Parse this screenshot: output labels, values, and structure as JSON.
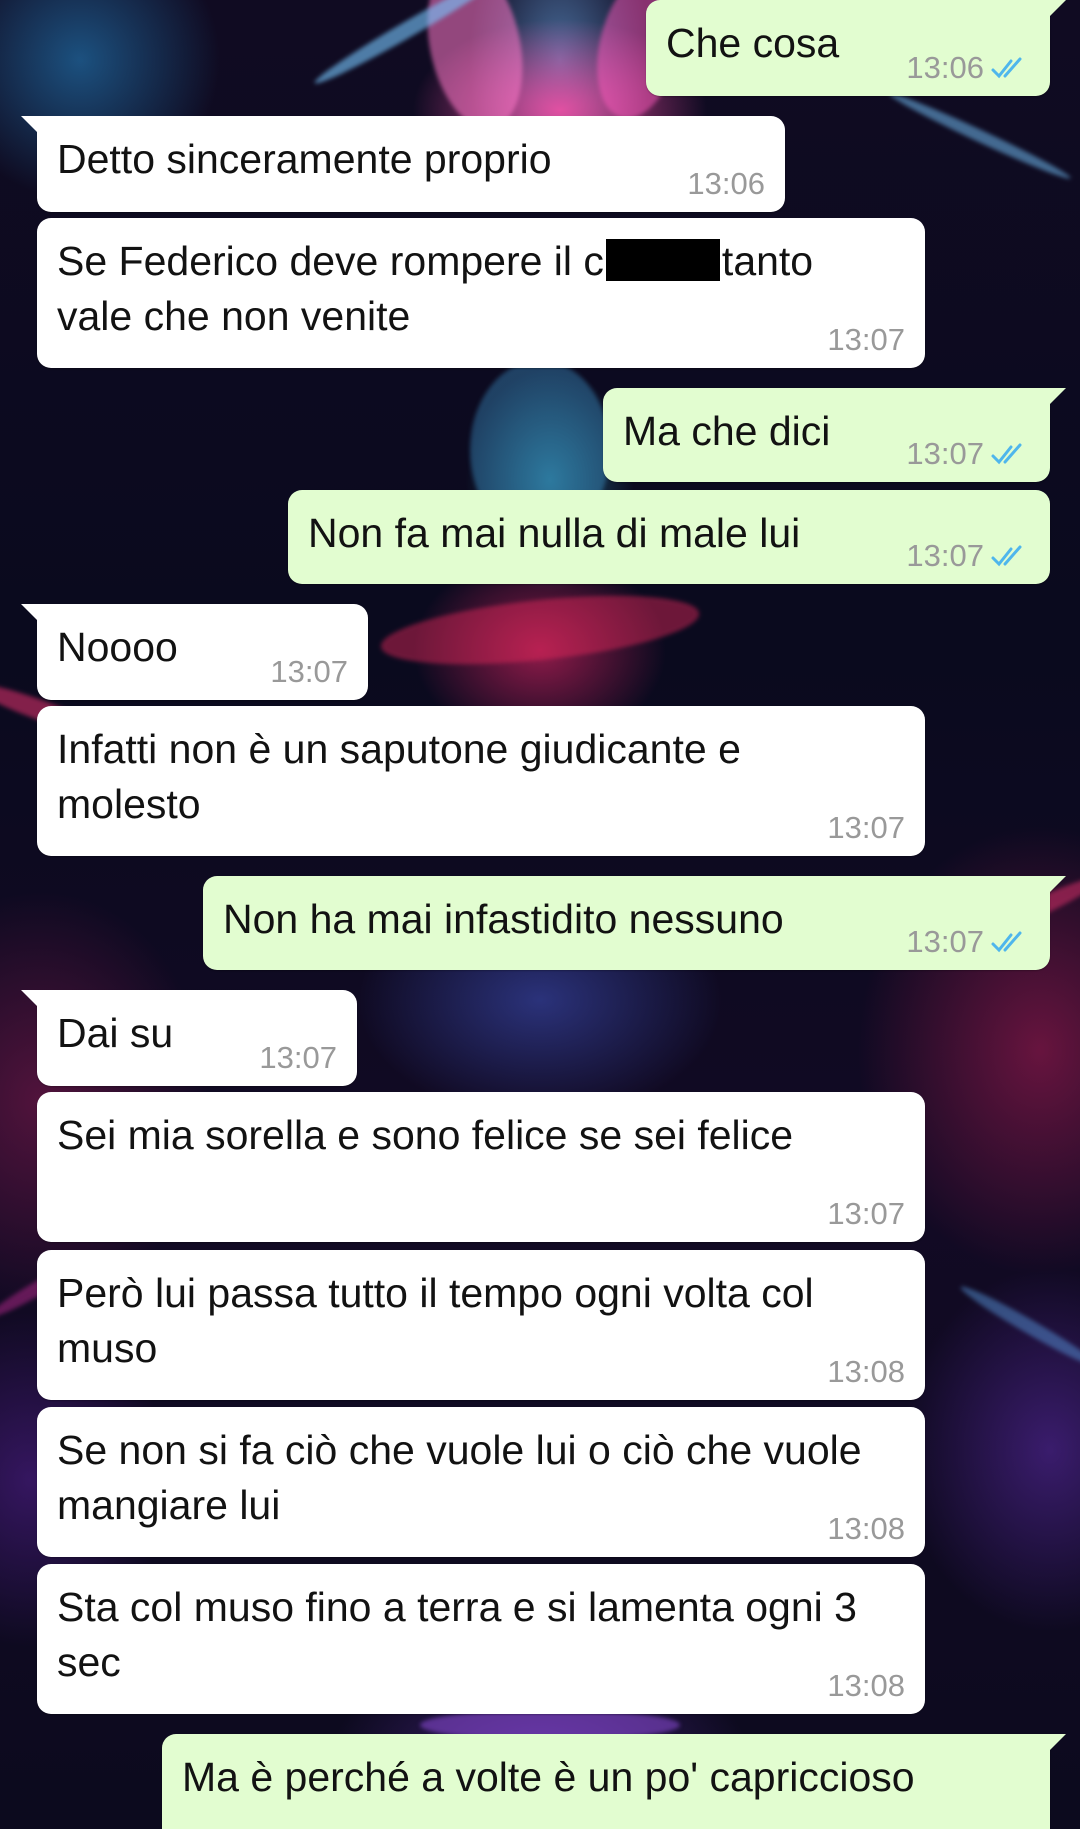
{
  "colors": {
    "incoming_bubble": "#ffffff",
    "outgoing_bubble": "#e2fdd0",
    "timestamp": "#999999",
    "read_ticks": "#4fb6ec",
    "redaction": "#000000"
  },
  "icons": {
    "read_receipt": "double-check-icon",
    "redaction": "redaction-bar"
  },
  "messages": [
    {
      "direction": "outgoing",
      "text": "Che cosa",
      "time": "13:06",
      "read": true
    },
    {
      "direction": "incoming",
      "text": "Detto sinceramente proprio",
      "time": "13:06"
    },
    {
      "direction": "incoming",
      "text_before": "Se Federico deve rompere il c",
      "text_after": "tanto vale che non venite",
      "time": "13:07",
      "redacted": true
    },
    {
      "direction": "outgoing",
      "text": "Ma che dici",
      "time": "13:07",
      "read": true
    },
    {
      "direction": "outgoing",
      "text": "Non fa mai nulla di male lui",
      "time": "13:07",
      "read": true
    },
    {
      "direction": "incoming",
      "text": "Noooo",
      "time": "13:07"
    },
    {
      "direction": "incoming",
      "text": "Infatti non è un saputone giudicante e molesto",
      "time": "13:07"
    },
    {
      "direction": "outgoing",
      "text": "Non ha mai infastidito nessuno",
      "time": "13:07",
      "read": true
    },
    {
      "direction": "incoming",
      "text": "Dai su",
      "time": "13:07"
    },
    {
      "direction": "incoming",
      "text": "Sei mia sorella e sono felice se sei felice",
      "time": "13:07"
    },
    {
      "direction": "incoming",
      "text": "Però lui passa tutto il tempo ogni volta col muso",
      "time": "13:08"
    },
    {
      "direction": "incoming",
      "text": "Se non si fa ciò che vuole lui o ciò che vuole mangiare lui",
      "time": "13:08"
    },
    {
      "direction": "incoming",
      "text": "Sta col muso fino a terra e si lamenta ogni 3 sec",
      "time": "13:08"
    },
    {
      "direction": "outgoing",
      "text": "Ma è perché a volte è un po' capriccioso",
      "time": ""
    }
  ]
}
